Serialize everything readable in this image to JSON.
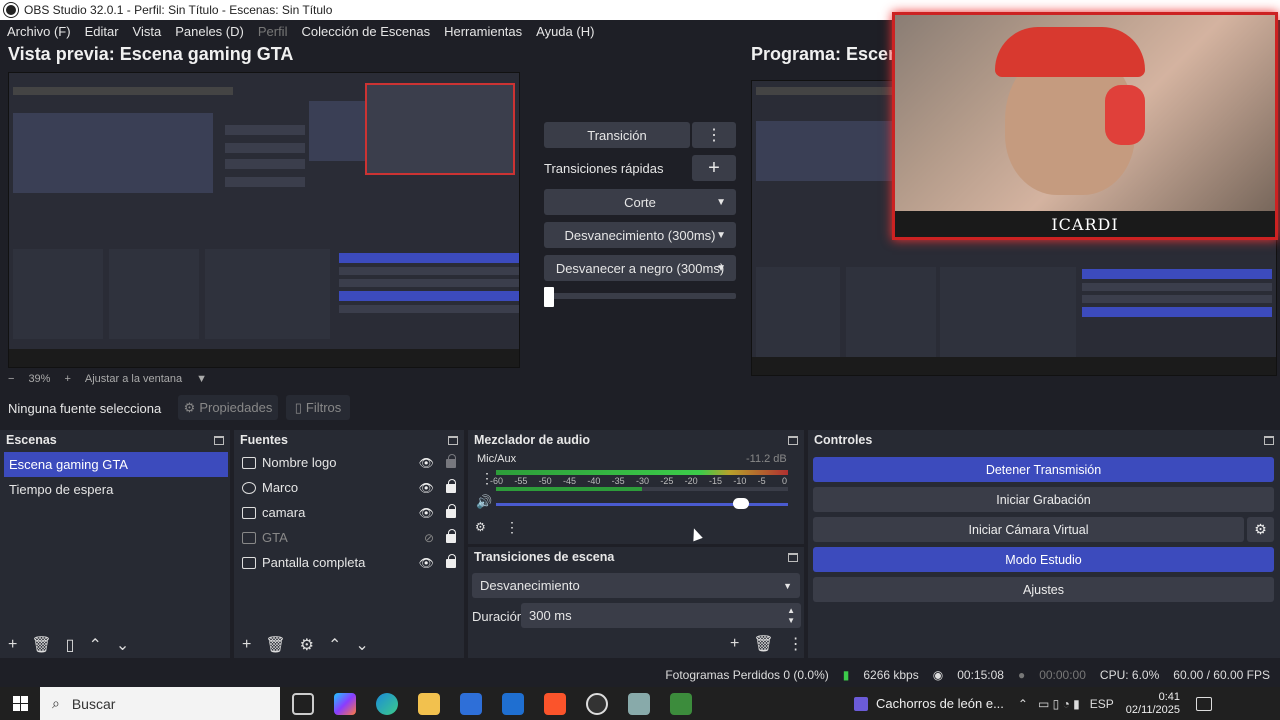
{
  "window": {
    "title": "OBS Studio 32.0.1 - Perfil: Sin Título - Escenas: Sin Título"
  },
  "menu": {
    "items": [
      "Archivo (F)",
      "Editar",
      "Vista",
      "Paneles (D)",
      "Perfil",
      "Colección de Escenas",
      "Herramientas",
      "Ayuda (H)"
    ]
  },
  "preview": {
    "title": "Vista previa: Escena gaming GTA",
    "zoom": "39%",
    "fit_label": "Ajustar a la ventana"
  },
  "program": {
    "title": "Programa: Escena"
  },
  "transitions_center": {
    "transition_button": "Transición",
    "quick_label": "Transiciones rápidas",
    "items": [
      "Corte",
      "Desvanecimiento (300ms)",
      "Desvanecer a negro (300ms)"
    ]
  },
  "overlay": {
    "name_label": "ICARDI"
  },
  "source_bar": {
    "none_selected": "Ninguna fuente selecciona",
    "properties": "Propiedades",
    "filters": "Filtros"
  },
  "scenes": {
    "title": "Escenas",
    "items": [
      "Escena gaming GTA",
      "Tiempo de espera"
    ]
  },
  "sources": {
    "title": "Fuentes",
    "items": [
      "Nombre logo",
      "Marco",
      "camara",
      "GTA",
      "Pantalla completa"
    ]
  },
  "mixer": {
    "title": "Mezclador de audio",
    "channel": "Mic/Aux",
    "level": "-11.2 dB",
    "ticks": [
      "-60",
      "-55",
      "-50",
      "-45",
      "-40",
      "-35",
      "-30",
      "-25",
      "-20",
      "-15",
      "-10",
      "-5",
      "0"
    ],
    "volume_fraction": 0.84
  },
  "scene_transitions": {
    "title": "Transiciones de escena",
    "selected": "Desvanecimiento",
    "duration_label": "Duración",
    "duration_value": "300 ms"
  },
  "controls": {
    "title": "Controles",
    "buttons": [
      "Detener Transmisión",
      "Iniciar Grabación",
      "Iniciar Cámara Virtual",
      "Modo Estudio",
      "Ajustes"
    ]
  },
  "status": {
    "dropped": "Fotogramas Perdidos 0 (0.0%)",
    "bitrate": "6266 kbps",
    "stream_time": "00:15:08",
    "rec_time": "00:00:00",
    "cpu": "CPU: 6.0%",
    "fps": "60.00 / 60.00 FPS"
  },
  "taskbar": {
    "search_placeholder": "Buscar",
    "media": "Cachorros de león e...",
    "lang": "ESP",
    "time": "0:41",
    "date": "02/11/2025"
  }
}
